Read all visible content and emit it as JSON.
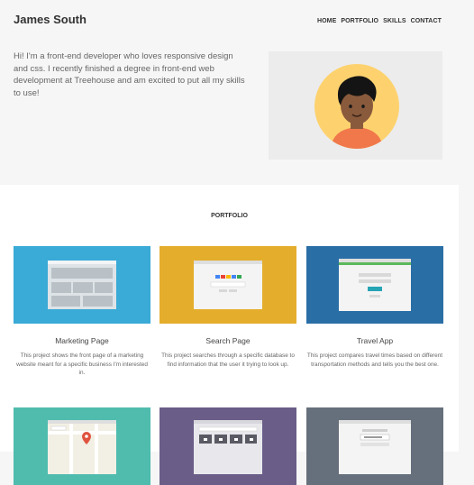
{
  "site": {
    "title": "James South"
  },
  "nav": {
    "items": [
      "HOME",
      "PORTFOLIO",
      "SKILLS",
      "CONTACT"
    ]
  },
  "intro": {
    "text": "Hi! I'm a front-end developer who loves responsive design and css. I recently finished a degree in front-end web development at Treehouse and am excited to put all my skills to use!"
  },
  "portfolio": {
    "title": "PORTFOLIO",
    "projects": [
      {
        "title": "Marketing Page",
        "description": "This project shows the front page of a marketing website meant for a specific business I'm interested in.",
        "color": "#3aaad6"
      },
      {
        "title": "Search Page",
        "description": "This project searches through a specific database to find information that the user it trying to look up.",
        "color": "#e4ad2c"
      },
      {
        "title": "Travel App",
        "description": "This project compares travel times based on different transportation methods and tells you the best one.",
        "color": "#2a6ea6"
      },
      {
        "title": "",
        "description": "",
        "color": "#4fbcae"
      },
      {
        "title": "",
        "description": "",
        "color": "#6a5d88"
      },
      {
        "title": "",
        "description": "",
        "color": "#66707c"
      }
    ]
  },
  "colors": {
    "page_bg": "#f6f6f6",
    "hero_bg": "#ececec",
    "avatar_bg": "#fdd26e",
    "shirt": "#f0784b"
  }
}
